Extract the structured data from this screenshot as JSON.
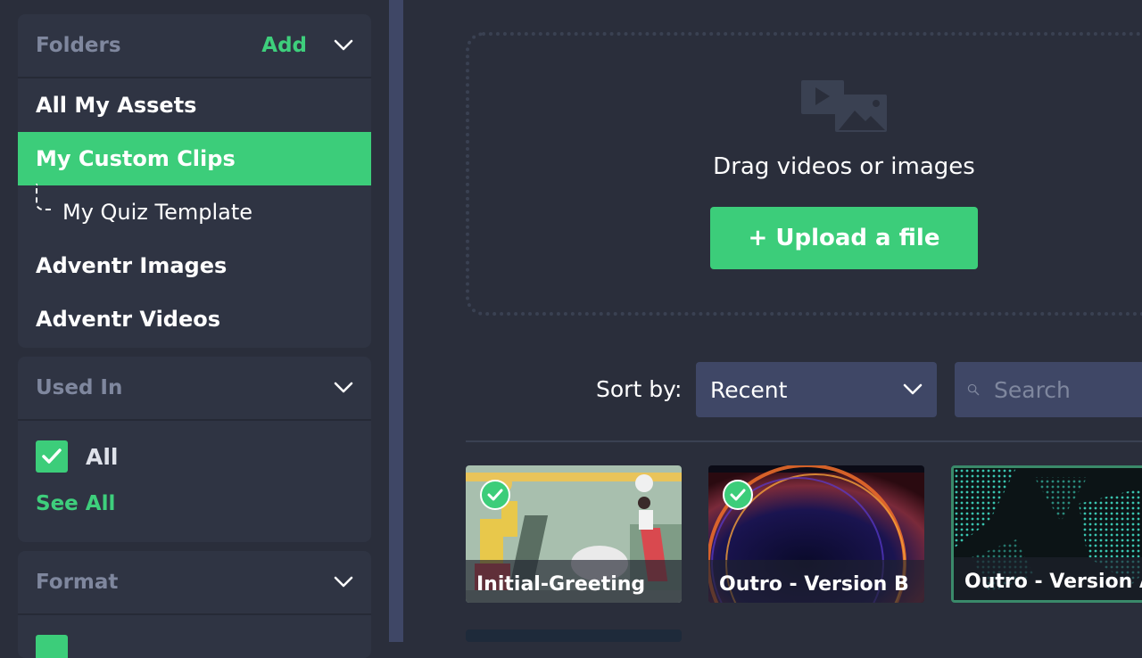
{
  "sidebar": {
    "folders": {
      "title": "Folders",
      "add_label": "Add",
      "items": [
        {
          "label": "All My Assets"
        },
        {
          "label": "My Custom Clips",
          "active": true
        },
        {
          "label": "My Quiz Template",
          "sub": true
        },
        {
          "label": "Adventr Images"
        },
        {
          "label": "Adventr Videos"
        }
      ]
    },
    "used_in": {
      "title": "Used In",
      "checkbox_label": "All",
      "see_all": "See All"
    },
    "format": {
      "title": "Format"
    }
  },
  "dropzone": {
    "text": "Drag videos or images",
    "upload_label": "+ Upload a file"
  },
  "toolbar": {
    "sort_label": "Sort by:",
    "sort_value": "Recent",
    "search_placeholder": "Search"
  },
  "assets": [
    {
      "title": "Initial-Greeting",
      "checked": true
    },
    {
      "title": "Outro - Version B",
      "checked": true
    },
    {
      "title": "Outro - Version A",
      "checked": false
    }
  ],
  "colors": {
    "accent": "#3ccd7a",
    "background": "#2a2e3b",
    "panel": "#2f3443",
    "muted_text": "#7f879e"
  }
}
